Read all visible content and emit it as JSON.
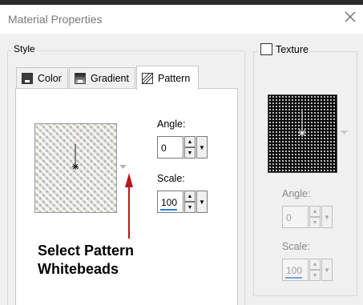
{
  "window": {
    "title": "Material Properties",
    "close_icon": "close-icon"
  },
  "style_group": {
    "legend": "Style"
  },
  "tabs": [
    {
      "label": "Color",
      "icon": "color-swatch-icon",
      "active": false
    },
    {
      "label": "Gradient",
      "icon": "gradient-icon",
      "active": false
    },
    {
      "label": "Pattern",
      "icon": "pattern-icon",
      "active": true
    }
  ],
  "pattern": {
    "angle_label": "Angle:",
    "angle_value": "0",
    "scale_label": "Scale:",
    "scale_value": "100"
  },
  "texture": {
    "checkbox_label": "Texture",
    "checked": false,
    "angle_label": "Angle:",
    "angle_value": "0",
    "scale_label": "Scale:",
    "scale_value": "100"
  },
  "annotation": {
    "line1": "Select Pattern",
    "line2": "Whitebeads",
    "arrow_color": "#c0151b"
  }
}
